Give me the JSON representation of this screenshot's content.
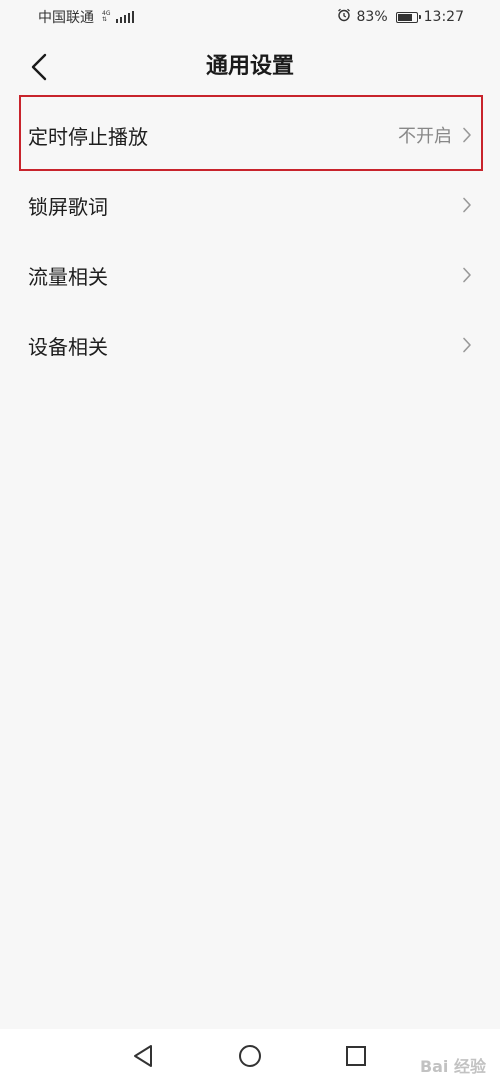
{
  "status_bar": {
    "carrier": "中国联通",
    "network_top": "4G",
    "network_bottom": "⇅",
    "battery_percent": "83%",
    "battery_level": 0.83,
    "time": "13:27"
  },
  "header": {
    "title": "通用设置"
  },
  "settings": {
    "items": [
      {
        "label": "定时停止播放",
        "value": "不开启"
      },
      {
        "label": "锁屏歌词",
        "value": ""
      },
      {
        "label": "流量相关",
        "value": ""
      },
      {
        "label": "设备相关",
        "value": ""
      }
    ]
  },
  "watermark": {
    "text": "Bai 经验"
  },
  "colors": {
    "highlight": "#c8242c",
    "background": "#f7f7f7"
  }
}
